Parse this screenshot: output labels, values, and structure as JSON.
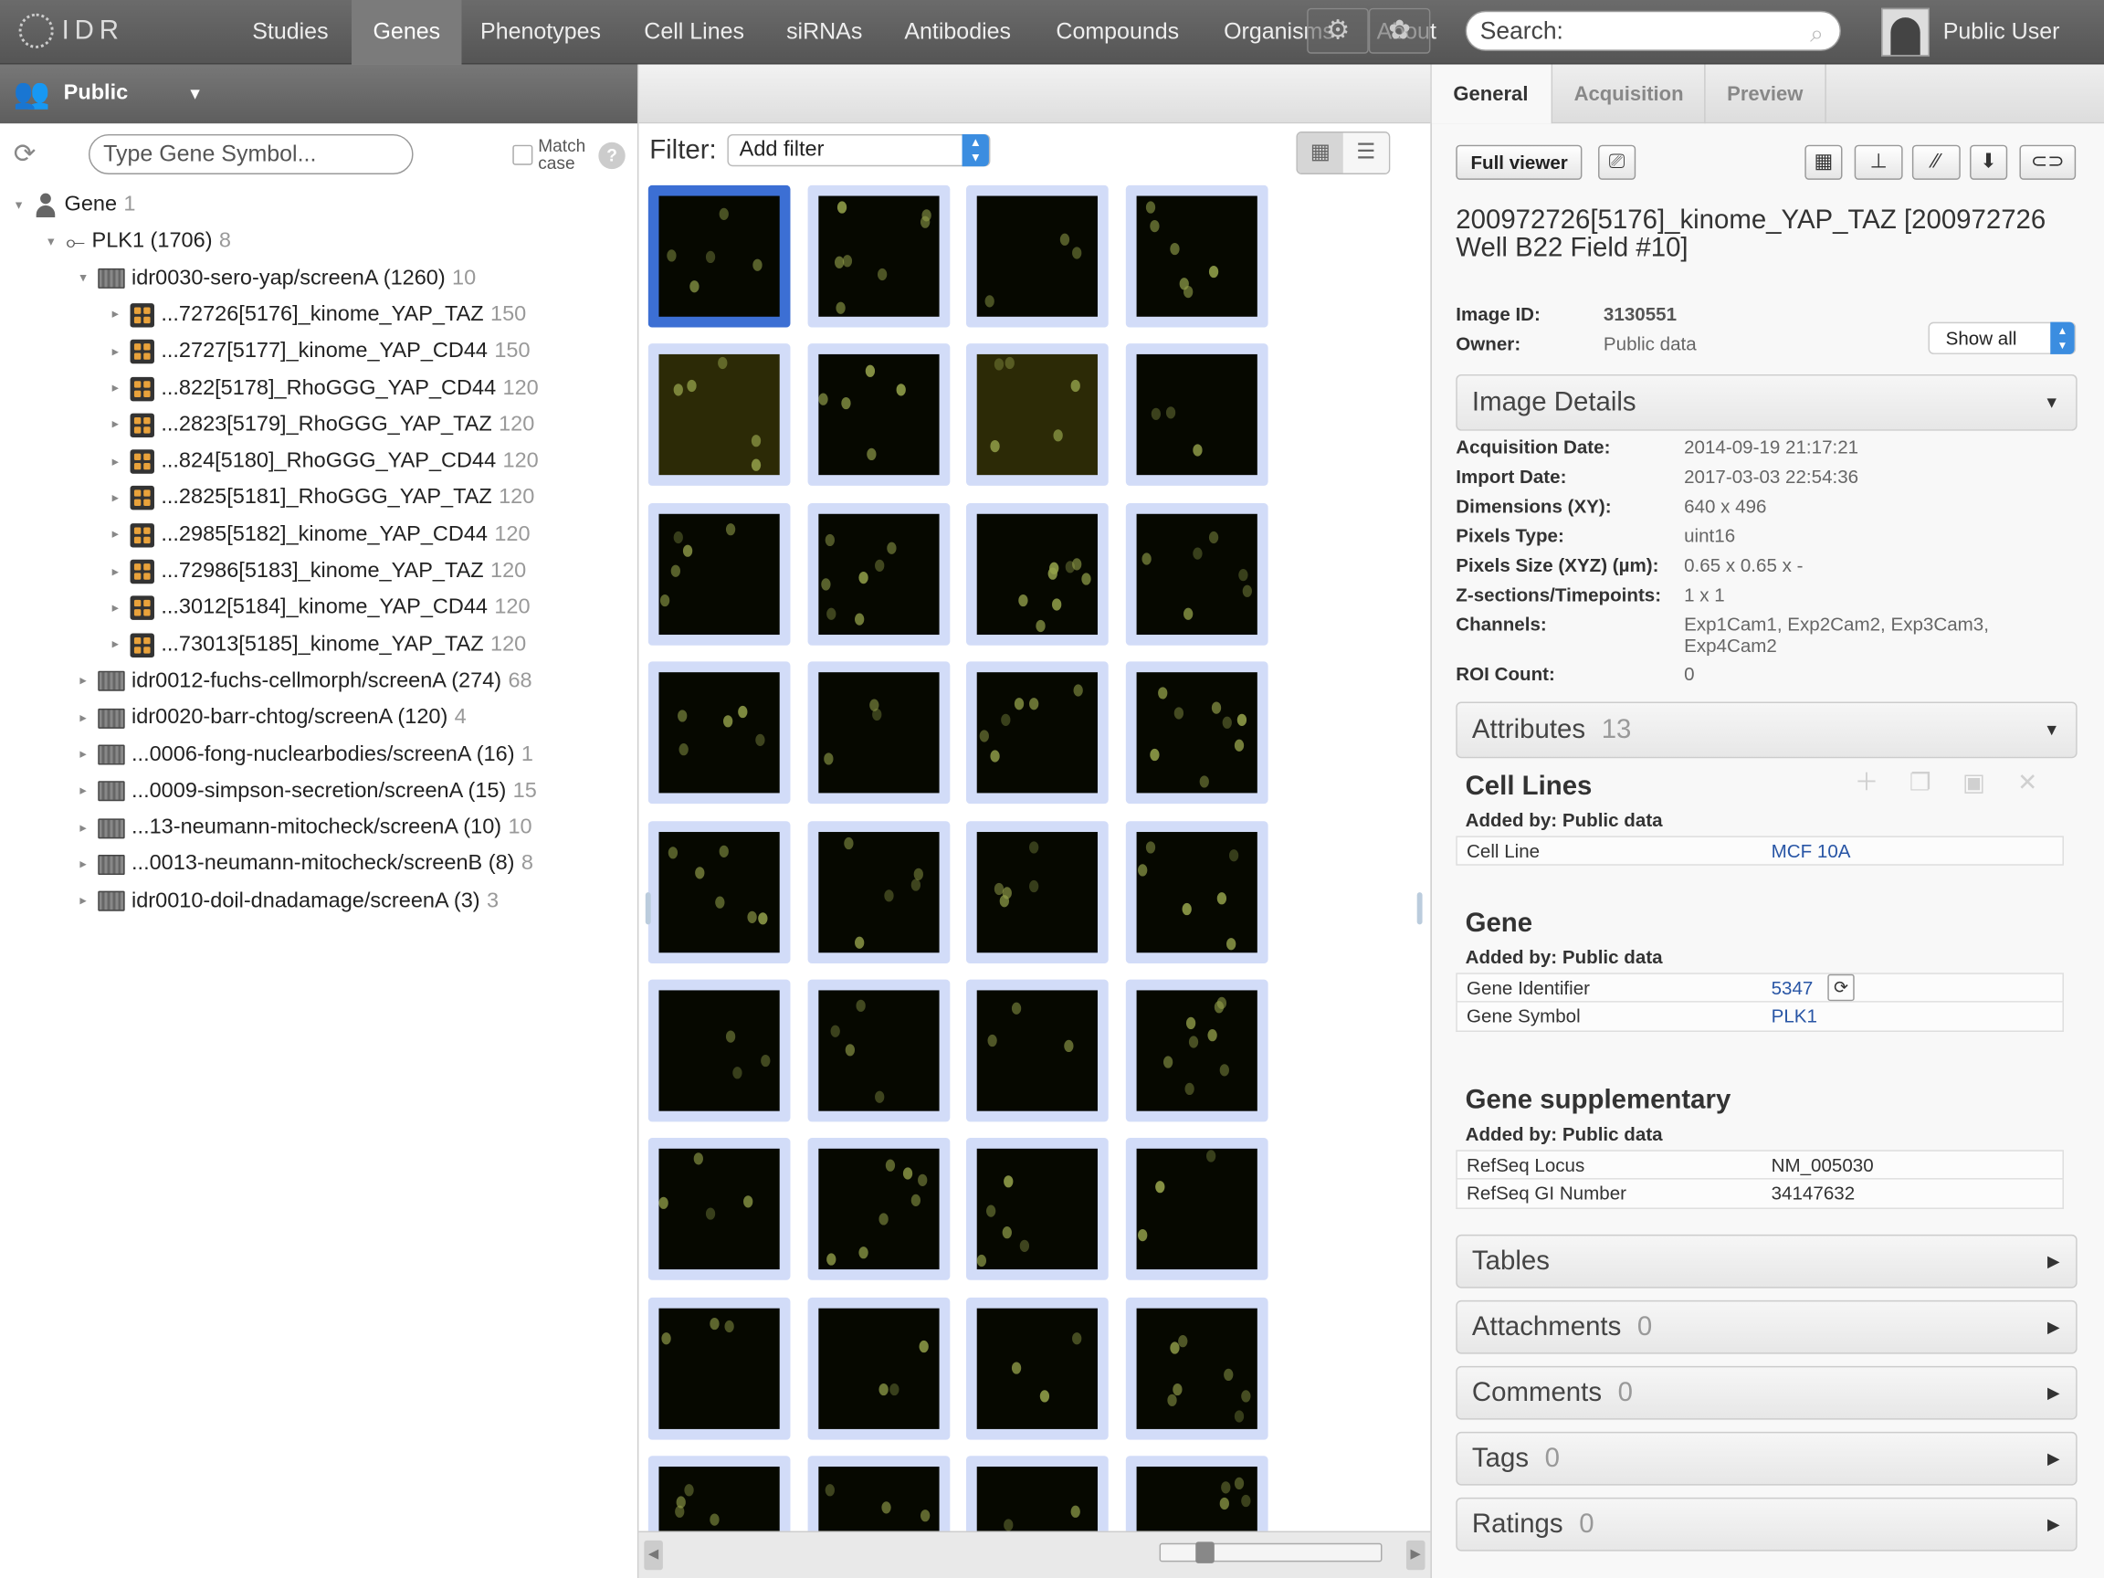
{
  "app": {
    "logo": "IDR"
  },
  "nav": {
    "items": [
      "Studies",
      "Genes",
      "Phenotypes",
      "Cell Lines",
      "siRNAs",
      "Antibodies",
      "Compounds",
      "Organisms",
      "About"
    ],
    "active": "Genes",
    "search_placeholder": "Search:",
    "user": "Public User"
  },
  "left": {
    "group": "Public",
    "search_placeholder": "Type Gene Symbol...",
    "match_case": "Match case",
    "help": "?",
    "tree": [
      {
        "label": "Gene",
        "count": "1",
        "icon": "person-icon",
        "level": 0,
        "toggle": "▾"
      },
      {
        "label": "PLK1 (1706)",
        "count": "8",
        "icon": "dna-icon",
        "level": 1,
        "toggle": "▾"
      },
      {
        "label": "idr0030-sero-yap/screenA (1260)",
        "count": "10",
        "icon": "screen-icon",
        "level": 2,
        "toggle": "▾"
      },
      {
        "label": "...72726[5176]_kinome_YAP_TAZ",
        "count": "150",
        "icon": "plate-icon",
        "level": 3,
        "toggle": "▸"
      },
      {
        "label": "...2727[5177]_kinome_YAP_CD44",
        "count": "150",
        "icon": "plate-icon",
        "level": 3,
        "toggle": "▸"
      },
      {
        "label": "...822[5178]_RhoGGG_YAP_CD44",
        "count": "120",
        "icon": "plate-icon",
        "level": 3,
        "toggle": "▸"
      },
      {
        "label": "...2823[5179]_RhoGGG_YAP_TAZ",
        "count": "120",
        "icon": "plate-icon",
        "level": 3,
        "toggle": "▸"
      },
      {
        "label": "...824[5180]_RhoGGG_YAP_CD44",
        "count": "120",
        "icon": "plate-icon",
        "level": 3,
        "toggle": "▸"
      },
      {
        "label": "...2825[5181]_RhoGGG_YAP_TAZ",
        "count": "120",
        "icon": "plate-icon",
        "level": 3,
        "toggle": "▸"
      },
      {
        "label": "...2985[5182]_kinome_YAP_CD44",
        "count": "120",
        "icon": "plate-icon",
        "level": 3,
        "toggle": "▸"
      },
      {
        "label": "...72986[5183]_kinome_YAP_TAZ",
        "count": "120",
        "icon": "plate-icon",
        "level": 3,
        "toggle": "▸"
      },
      {
        "label": "...3012[5184]_kinome_YAP_CD44",
        "count": "120",
        "icon": "plate-icon",
        "level": 3,
        "toggle": "▸"
      },
      {
        "label": "...73013[5185]_kinome_YAP_TAZ",
        "count": "120",
        "icon": "plate-icon",
        "level": 3,
        "toggle": "▸"
      },
      {
        "label": "idr0012-fuchs-cellmorph/screenA (274)",
        "count": "68",
        "icon": "screen-icon",
        "level": 2,
        "toggle": "▸"
      },
      {
        "label": "idr0020-barr-chtog/screenA (120)",
        "count": "4",
        "icon": "screen-icon",
        "level": 2,
        "toggle": "▸"
      },
      {
        "label": "...0006-fong-nuclearbodies/screenA (16)",
        "count": "1",
        "icon": "screen-icon",
        "level": 2,
        "toggle": "▸"
      },
      {
        "label": "...0009-simpson-secretion/screenA (15)",
        "count": "15",
        "icon": "screen-icon",
        "level": 2,
        "toggle": "▸"
      },
      {
        "label": "...13-neumann-mitocheck/screenA (10)",
        "count": "10",
        "icon": "screen-icon",
        "level": 2,
        "toggle": "▸"
      },
      {
        "label": "...0013-neumann-mitocheck/screenB (8)",
        "count": "8",
        "icon": "screen-icon",
        "level": 2,
        "toggle": "▸"
      },
      {
        "label": "idr0010-doil-dnadamage/screenA (3)",
        "count": "3",
        "icon": "screen-icon",
        "level": 2,
        "toggle": "▸"
      }
    ]
  },
  "center": {
    "filter_label": "Filter:",
    "filter_value": "Add filter",
    "thumbnail_count_visible": 36,
    "selected_index": 0
  },
  "right": {
    "tabs": [
      "General",
      "Acquisition",
      "Preview"
    ],
    "active_tab": "General",
    "full_viewer": "Full viewer",
    "title": "200972726[5176]_kinome_YAP_TAZ [200972726 Well B22 Field #10]",
    "image_id_label": "Image ID:",
    "image_id": "3130551",
    "owner_label": "Owner:",
    "owner": "Public data",
    "show_all": "Show all",
    "image_details": "Image Details",
    "details": [
      {
        "k": "Acquisition Date:",
        "v": "2014-09-19 21:17:21"
      },
      {
        "k": "Import Date:",
        "v": "2017-03-03 22:54:36"
      },
      {
        "k": "Dimensions (XY):",
        "v": "640 x 496"
      },
      {
        "k": "Pixels Type:",
        "v": "uint16"
      },
      {
        "k": "Pixels Size (XYZ) (µm):",
        "v": "0.65 x 0.65 x -"
      },
      {
        "k": "Z-sections/Timepoints:",
        "v": "1 x 1"
      },
      {
        "k": "Channels:",
        "v": "Exp1Cam1, Exp2Cam2, Exp3Cam3, Exp4Cam2"
      },
      {
        "k": "ROI Count:",
        "v": "0"
      }
    ],
    "attributes": {
      "label": "Attributes",
      "count": "13"
    },
    "annotations": [
      {
        "heading": "Cell Lines",
        "added_by": "Added by: Public data",
        "rows": [
          {
            "k": "Cell Line",
            "v": "MCF 10A",
            "link": true
          }
        ]
      },
      {
        "heading": "Gene",
        "added_by": "Added by: Public data",
        "rows": [
          {
            "k": "Gene Identifier",
            "v": "5347",
            "link": true
          },
          {
            "k": "Gene Symbol",
            "v": "PLK1",
            "link": true
          }
        ]
      },
      {
        "heading": "Gene supplementary",
        "added_by": "Added by: Public data",
        "rows": [
          {
            "k": "RefSeq Locus",
            "v": "NM_005030",
            "link": false
          },
          {
            "k": "RefSeq GI Number",
            "v": "34147632",
            "link": false
          }
        ]
      }
    ],
    "sections": [
      {
        "label": "Tables",
        "count": ""
      },
      {
        "label": "Attachments",
        "count": "0"
      },
      {
        "label": "Comments",
        "count": "0"
      },
      {
        "label": "Tags",
        "count": "0"
      },
      {
        "label": "Ratings",
        "count": "0"
      }
    ]
  }
}
